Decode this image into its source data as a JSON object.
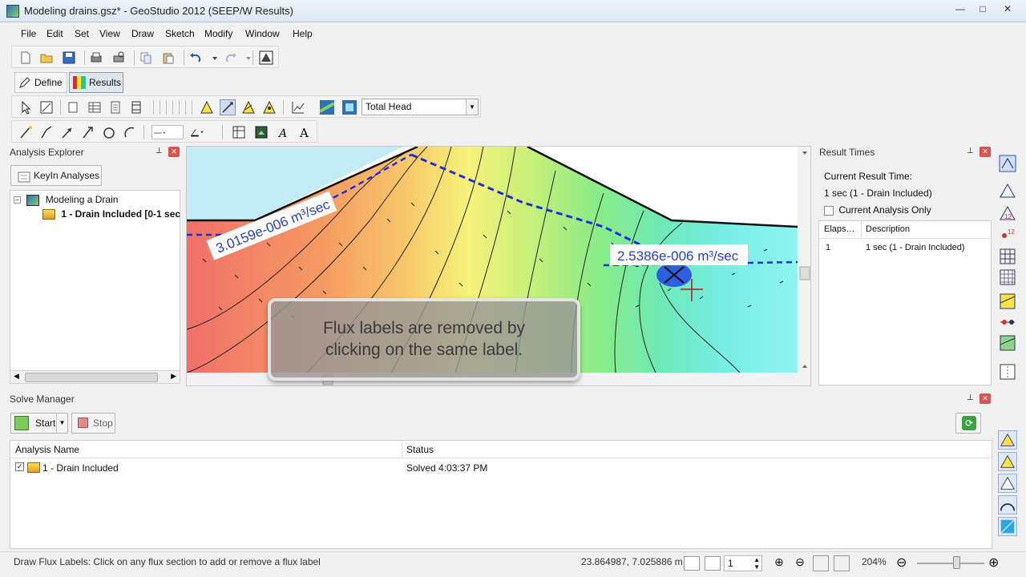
{
  "window": {
    "title": "Modeling drains.gsz* - GeoStudio 2012 (SEEP/W Results)",
    "min": "—",
    "max": "□",
    "close": "✕"
  },
  "menu": [
    "File",
    "Edit",
    "Set",
    "View",
    "Draw",
    "Sketch",
    "Modify",
    "Window",
    "Help"
  ],
  "modes": {
    "define": "Define",
    "results": "Results"
  },
  "contour_select": {
    "value": "Total Head"
  },
  "analysis_explorer": {
    "title": "Analysis Explorer",
    "keyin_label": "KeyIn Analyses",
    "tree": {
      "root": "Modeling a Drain",
      "child": "1 - Drain Included [0-1 sec"
    }
  },
  "result_times": {
    "title": "Result Times",
    "current_label": "Current Result Time:",
    "current_value": "1 sec (1 - Drain Included)",
    "current_only_label": "Current Analysis Only",
    "columns": [
      "Elaps…",
      "Description"
    ],
    "rows": [
      {
        "elapsed": "1",
        "description": "1 sec (1 - Drain Included)"
      }
    ]
  },
  "canvas": {
    "flux_left": "3.0159e-006 m³/sec",
    "flux_right": "2.5386e-006 m³/sec"
  },
  "overlay": {
    "line1": "Flux labels are removed by",
    "line2": "clicking on the same label."
  },
  "solve_manager": {
    "title": "Solve Manager",
    "start": "Start",
    "stop": "Stop",
    "columns": [
      "Analysis Name",
      "Status"
    ],
    "rows": [
      {
        "name": "1 - Drain Included",
        "status": "Solved 4:03:37 PM"
      }
    ]
  },
  "statusbar": {
    "message": "Draw Flux Labels:  Click on any flux section to add or remove a flux label",
    "coords": "23.864987, 7.025886 m",
    "spin": "1",
    "zoom": "204%"
  },
  "colors": {
    "accent": "#2a4fd6",
    "flux_line": "#1f2ee0"
  }
}
